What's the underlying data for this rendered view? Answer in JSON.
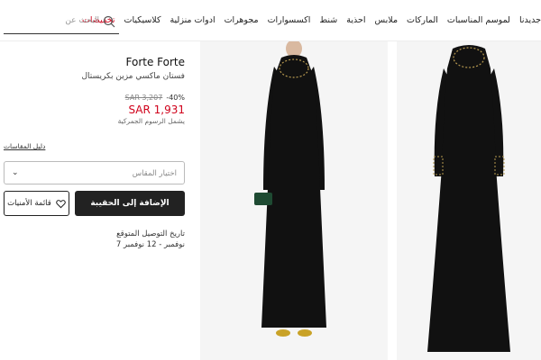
{
  "nav": {
    "items": [
      {
        "label": "جديدنا"
      },
      {
        "label": "لموسم المناسبات"
      },
      {
        "label": "الماركات"
      },
      {
        "label": "ملابس"
      },
      {
        "label": "احذية"
      },
      {
        "label": "شنط"
      },
      {
        "label": "اكسسوارات"
      },
      {
        "label": "مجوهرات"
      },
      {
        "label": "ادوات منزلية"
      },
      {
        "label": "كلاسيكيات"
      },
      {
        "label": "تخفيضات"
      }
    ],
    "search_placeholder": "البحث عن"
  },
  "product": {
    "brand": "Forte Forte",
    "title": "فستان ماكسي مزين بكريستال",
    "discount": "40%-",
    "old_price": "SAR 3,207",
    "price": "SAR 1,931",
    "duties_note": "يشمل الرسوم الجمركية",
    "size_guide": "دليل المقاسات",
    "size_placeholder": "اختيار المقاس",
    "add_to_bag": "الإضافة إلى الحقيبة",
    "wishlist": "قائمة الأمنيات",
    "delivery_label": "تاريخ التوصيل المتوقع",
    "delivery_dates": "7 نوفمبر - 12 نوفمبر"
  },
  "colors": {
    "accent_sale": "#d0021b",
    "button_dark": "#222222",
    "image_bg": "#f5f5f5",
    "dress": "#111111"
  }
}
